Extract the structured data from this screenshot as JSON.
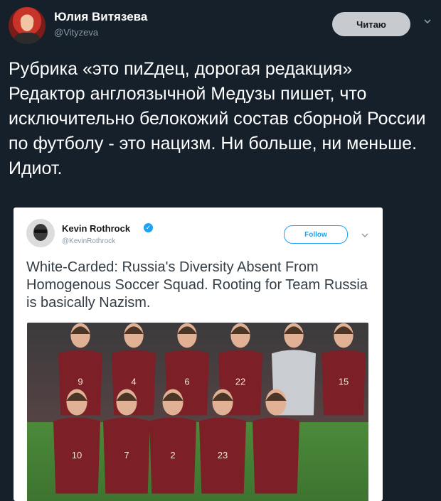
{
  "author": {
    "name": "Юлия Витязева",
    "handle": "@Vityzeva",
    "follow_label": "Читаю"
  },
  "tweet": {
    "text": "Рубрика «это пиZдец, дорогая редакция»\nРедактор англоязычной Медузы пишет, что исключительно белокожий состав сборной России по футболу - это нацизм. Ни больше, ни меньше.\nИдиот."
  },
  "quoted": {
    "name": "Kevin Rothrock",
    "handle": "@KevinRothrock",
    "follow_label": "Follow",
    "text": "White-Carded: Russia's Diversity Absent From Homogenous Soccer Squad. Rooting for Team Russia is basically Nazism.",
    "photo": {
      "back_row_numbers": [
        "9",
        "4",
        "6",
        "22",
        "",
        "15"
      ],
      "front_row_numbers": [
        "10",
        "7",
        "2",
        "23",
        ""
      ]
    }
  },
  "colors": {
    "background": "#15202b",
    "kit": "#7d1f26",
    "accent": "#1da1f2"
  }
}
